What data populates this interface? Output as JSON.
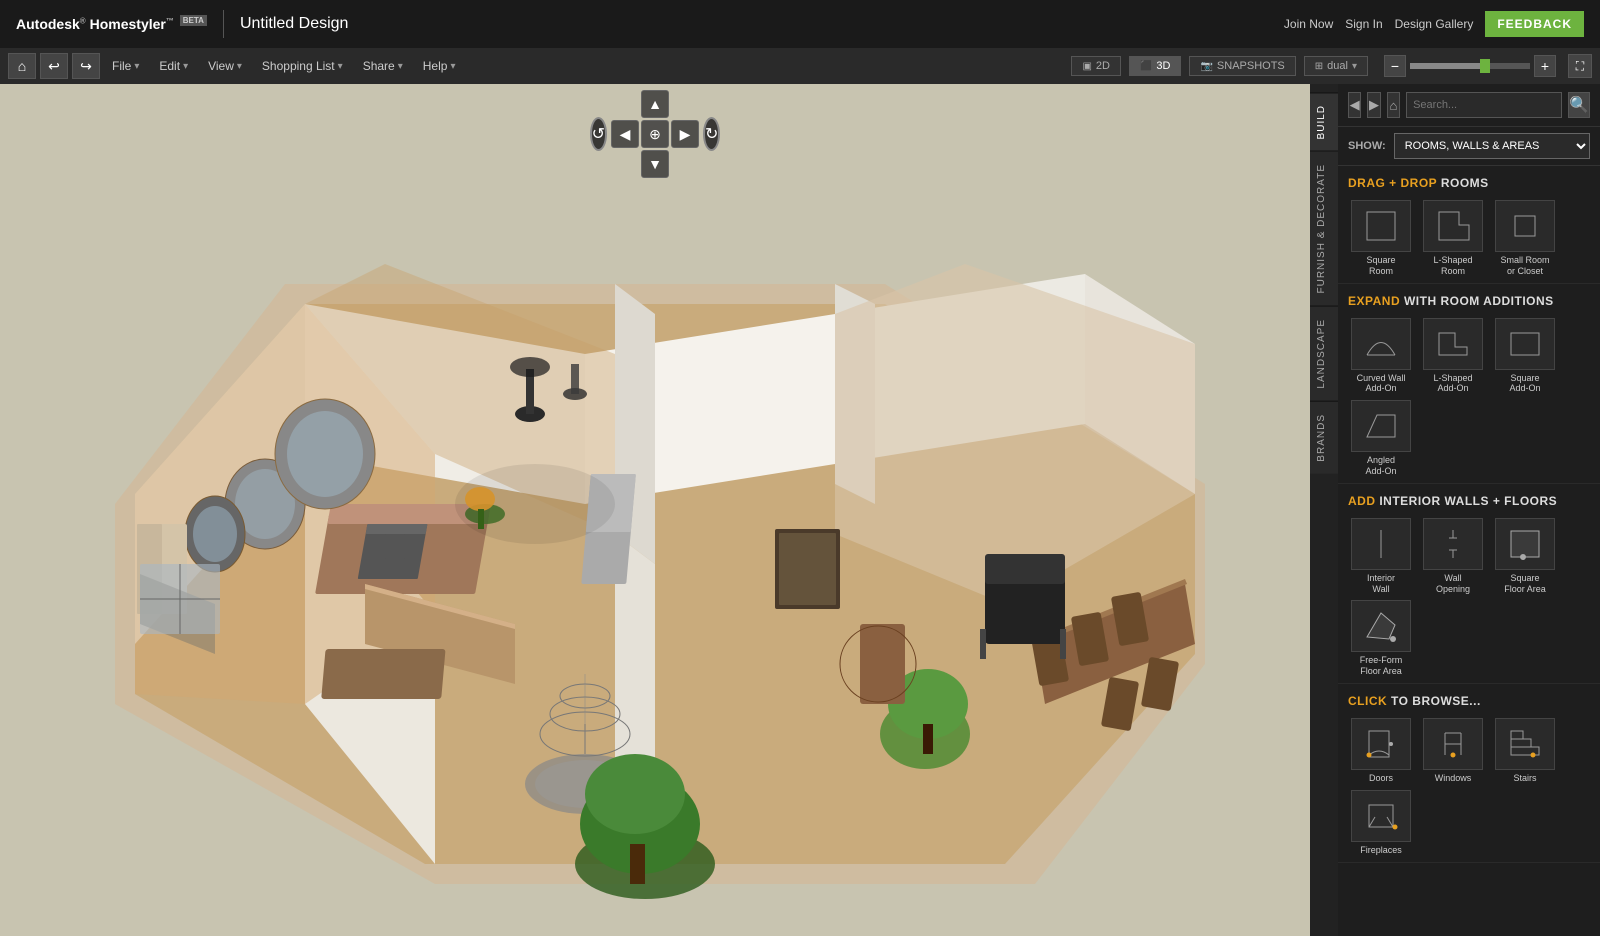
{
  "topbar": {
    "logo": "Autodesk® Homestyler™",
    "beta": "BETA",
    "title": "Untitled Design",
    "nav_links": [
      "Join Now",
      "Sign In",
      "Design Gallery"
    ],
    "feedback": "FEEDBACK"
  },
  "menubar": {
    "items": [
      "File",
      "Edit",
      "View",
      "Shopping List",
      "Share",
      "Help"
    ],
    "view_2d": "2D",
    "view_3d": "3D",
    "snapshots": "SNAPSHOTS",
    "dual": "dual"
  },
  "panel": {
    "build_label": "BUILD",
    "furnish_label": "FURNISH & DECORATE",
    "landscape_label": "LANDSCAPE",
    "brands_label": "BRANDS",
    "show_label": "SHOW:",
    "show_option": "ROOMS, WALLS & AREAS",
    "sections": {
      "drag_drop": {
        "prefix": "DRAG + DROP",
        "suffix": "ROOMS",
        "items": [
          {
            "label": "Square\nRoom",
            "shape": "square"
          },
          {
            "label": "L-Shaped\nRoom",
            "shape": "l-shaped"
          },
          {
            "label": "Small Room\nor Closet",
            "shape": "small-room"
          }
        ]
      },
      "expand": {
        "prefix": "EXPAND",
        "suffix": "WITH ROOM ADDITIONS",
        "items": [
          {
            "label": "Curved Wall\nAdd-On",
            "shape": "curved-wall"
          },
          {
            "label": "L-Shaped\nAdd-On",
            "shape": "l-shaped-addon"
          },
          {
            "label": "Square\nAdd-On",
            "shape": "square-addon"
          },
          {
            "label": "Angled\nAdd-On",
            "shape": "angled-addon"
          }
        ]
      },
      "interior": {
        "prefix": "ADD",
        "suffix": "INTERIOR WALLS + FLOORS",
        "items": [
          {
            "label": "Interior\nWall",
            "shape": "interior-wall"
          },
          {
            "label": "Wall\nOpening",
            "shape": "wall-opening"
          },
          {
            "label": "Square\nFloor Area",
            "shape": "square-floor"
          },
          {
            "label": "Free-Form\nFloor Area",
            "shape": "freeform-floor"
          }
        ]
      },
      "browse": {
        "prefix": "CLICK",
        "suffix": "TO BROWSE...",
        "items": [
          {
            "label": "Doors",
            "shape": "doors"
          },
          {
            "label": "Windows",
            "shape": "windows"
          },
          {
            "label": "Stairs",
            "shape": "stairs"
          },
          {
            "label": "Fireplaces",
            "shape": "fireplaces"
          }
        ]
      }
    }
  }
}
